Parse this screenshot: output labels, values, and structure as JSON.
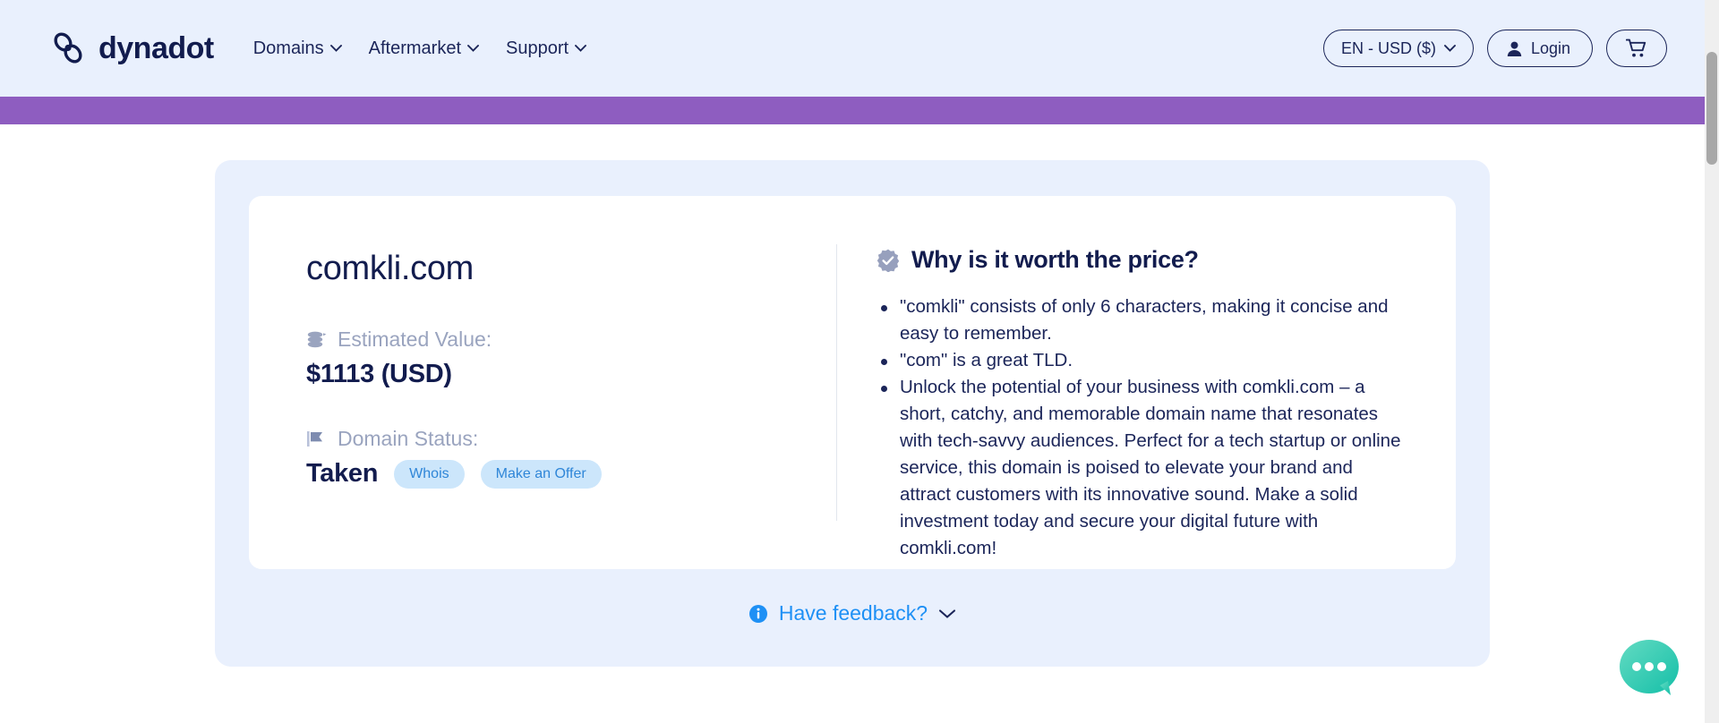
{
  "header": {
    "brand": "dynadot",
    "logo_icon": "dynadot-infinity-logo",
    "nav": [
      {
        "label": "Domains",
        "icon": "chevron-down-icon"
      },
      {
        "label": "Aftermarket",
        "icon": "chevron-down-icon"
      },
      {
        "label": "Support",
        "icon": "chevron-down-icon"
      }
    ],
    "locale_selector": {
      "label": "EN - USD ($)",
      "icon": "chevron-down-icon"
    },
    "login": {
      "label": "Login",
      "icon": "user-icon"
    },
    "cart": {
      "icon": "shopping-cart-icon"
    }
  },
  "banner": {
    "color": "#8e5dc0"
  },
  "result": {
    "domain": "comkli.com",
    "estimated_value": {
      "label": "Estimated Value:",
      "icon": "coins-stack-icon",
      "value": "$1113 (USD)"
    },
    "domain_status": {
      "label": "Domain Status:",
      "icon": "flag-icon",
      "value": "Taken",
      "actions": [
        {
          "label": "Whois"
        },
        {
          "label": "Make an Offer"
        }
      ]
    },
    "why_worth": {
      "title": "Why is it worth the price?",
      "icon": "verified-badge-icon",
      "bullets": [
        "\"comkli\" consists of only 6 characters, making it concise and easy to remember.",
        "\"com\" is a great TLD.",
        "Unlock the potential of your business with comkli.com – a short, catchy, and memorable domain name that resonates with tech-savvy audiences. Perfect for a tech startup or online service, this domain is poised to elevate your brand and attract customers with its innovative sound. Make a solid investment today and secure your digital future with comkli.com!"
      ]
    }
  },
  "feedback": {
    "label": "Have feedback?",
    "info_icon": "info-circle-icon",
    "chevron_icon": "chevron-down-icon"
  },
  "chat": {
    "icon": "chat-bubble-icon",
    "color": "#2ec9b0"
  },
  "colors": {
    "header_bg": "#e9f0fd",
    "banner": "#8e5dc0",
    "card_bg": "#e9f0fd",
    "accent_blue": "#1e90f5",
    "tag_bg": "#cce6fb",
    "tag_text": "#2f86d8",
    "navy": "#121c4e"
  }
}
